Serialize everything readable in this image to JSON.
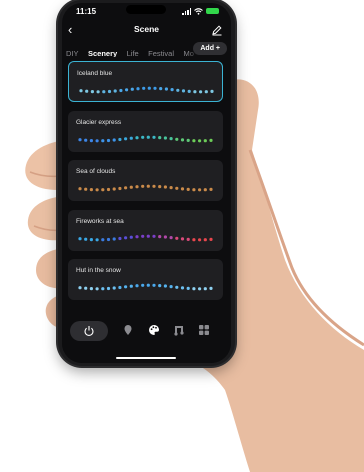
{
  "status_bar": {
    "time": "11:15"
  },
  "nav": {
    "title": "Scene"
  },
  "tabs": [
    {
      "label": "DIY",
      "active": false
    },
    {
      "label": "Scenery",
      "active": true
    },
    {
      "label": "Life",
      "active": false
    },
    {
      "label": "Festival",
      "active": false
    },
    {
      "label": "Mo",
      "active": false
    }
  ],
  "add_button": {
    "label": "Add +"
  },
  "scenes": [
    {
      "name": "Iceland blue",
      "selected": true,
      "colors": [
        "#7ec8e3",
        "#5fb4e0",
        "#4aa6e8",
        "#3d9be8",
        "#4aa6e8",
        "#5fb4e0",
        "#7ec8e3"
      ]
    },
    {
      "name": "Glacier express",
      "selected": false,
      "colors": [
        "#3d86e8",
        "#3d93e8",
        "#3aa8dc",
        "#3cb8c6",
        "#49c49b",
        "#5ec877",
        "#6ccc58"
      ]
    },
    {
      "name": "Sea of clouds",
      "selected": false,
      "colors": [
        "#c98a4a",
        "#c98a4a",
        "#c98a4a",
        "#c98a4a",
        "#c98a4a",
        "#c98a4a",
        "#c98a4a"
      ]
    },
    {
      "name": "Fireworks at sea",
      "selected": false,
      "colors": [
        "#3aa8e6",
        "#3b7be0",
        "#5a4fd8",
        "#7a3fc8",
        "#b048a8",
        "#d84a7a",
        "#e8464d"
      ]
    },
    {
      "name": "Hut in the snow",
      "selected": false,
      "colors": [
        "#8ed0f0",
        "#6cbff0",
        "#55b2ee",
        "#4aa8ec",
        "#55b2ee",
        "#6cbff0",
        "#8ed0f0"
      ]
    }
  ],
  "bottom_nav": [
    "power-icon",
    "location-pin-icon",
    "palette-icon",
    "music-icon",
    "grid-icon"
  ],
  "accent_color": "#3bb3d3"
}
